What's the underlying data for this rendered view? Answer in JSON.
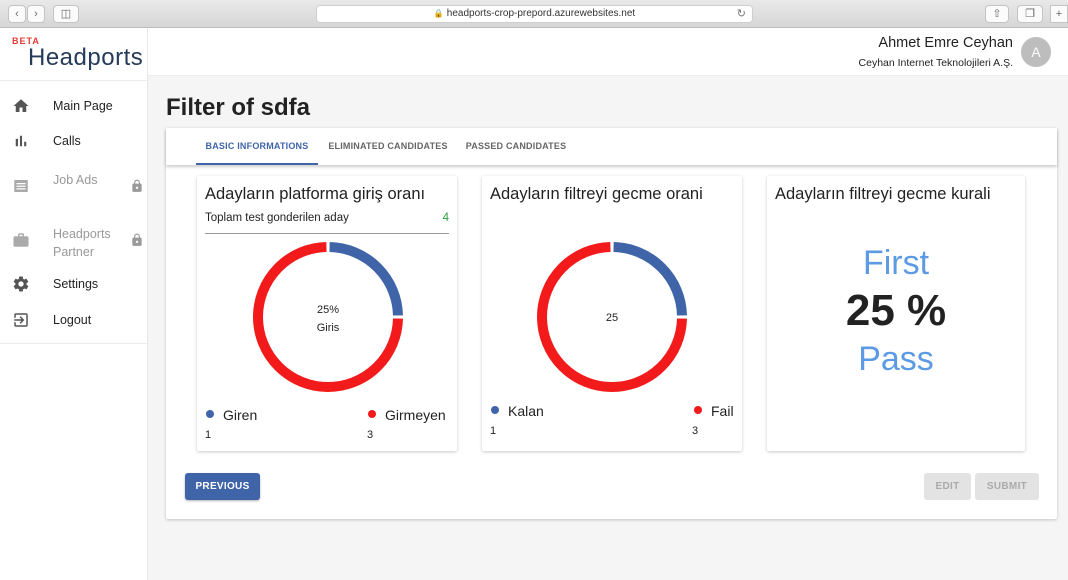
{
  "browser": {
    "url": "headports-crop-prepord.azurewebsites.net"
  },
  "logo": {
    "beta": "BETA",
    "name": "Headports"
  },
  "sidebar": {
    "items": [
      {
        "label": "Main Page",
        "icon": "home-icon"
      },
      {
        "label": "Calls",
        "icon": "bar-chart-icon"
      },
      {
        "label": "Job Ads",
        "icon": "list-icon",
        "locked": true
      },
      {
        "label": "Headports Partner",
        "icon": "briefcase-icon",
        "locked": true
      },
      {
        "label": "Settings",
        "icon": "gear-icon"
      },
      {
        "label": "Logout",
        "icon": "logout-icon"
      }
    ]
  },
  "header": {
    "user_name": "Ahmet Emre Ceyhan",
    "company": "Ceyhan Internet Teknolojileri A.Ş.",
    "avatar_initial": "A"
  },
  "page": {
    "title": "Filter of sdfa"
  },
  "tabs": [
    {
      "label": "BASIC INFORMATIONS",
      "active": true
    },
    {
      "label": "ELIMINATED CANDIDATES",
      "active": false
    },
    {
      "label": "PASSED CANDIDATES",
      "active": false
    }
  ],
  "panels": {
    "entry": {
      "title": "Adayların platforma giriş oranı",
      "subtitle": "Toplam test gonderilen aday",
      "subtitle_value": "4",
      "center_value": "25%",
      "center_label": "Giris",
      "fraction": 0.25,
      "legend": [
        {
          "label": "Giren",
          "count": "1",
          "color": "#3f64a8"
        },
        {
          "label": "Girmeyen",
          "count": "3",
          "color": "#f21a1a"
        }
      ]
    },
    "pass": {
      "title": "Adayların filtreyi gecme orani",
      "center_value": "25",
      "fraction": 0.25,
      "legend": [
        {
          "label": "Kalan",
          "count": "1",
          "color": "#3f64a8"
        },
        {
          "label": "Fail",
          "count": "3",
          "color": "#f21a1a"
        }
      ]
    },
    "rule": {
      "title": "Adayların filtreyi gecme kurali",
      "top": "First",
      "percent": "25 %",
      "bottom": "Pass"
    }
  },
  "buttons": {
    "previous": "PREVIOUS",
    "edit": "EDIT",
    "submit": "SUBMIT"
  }
}
